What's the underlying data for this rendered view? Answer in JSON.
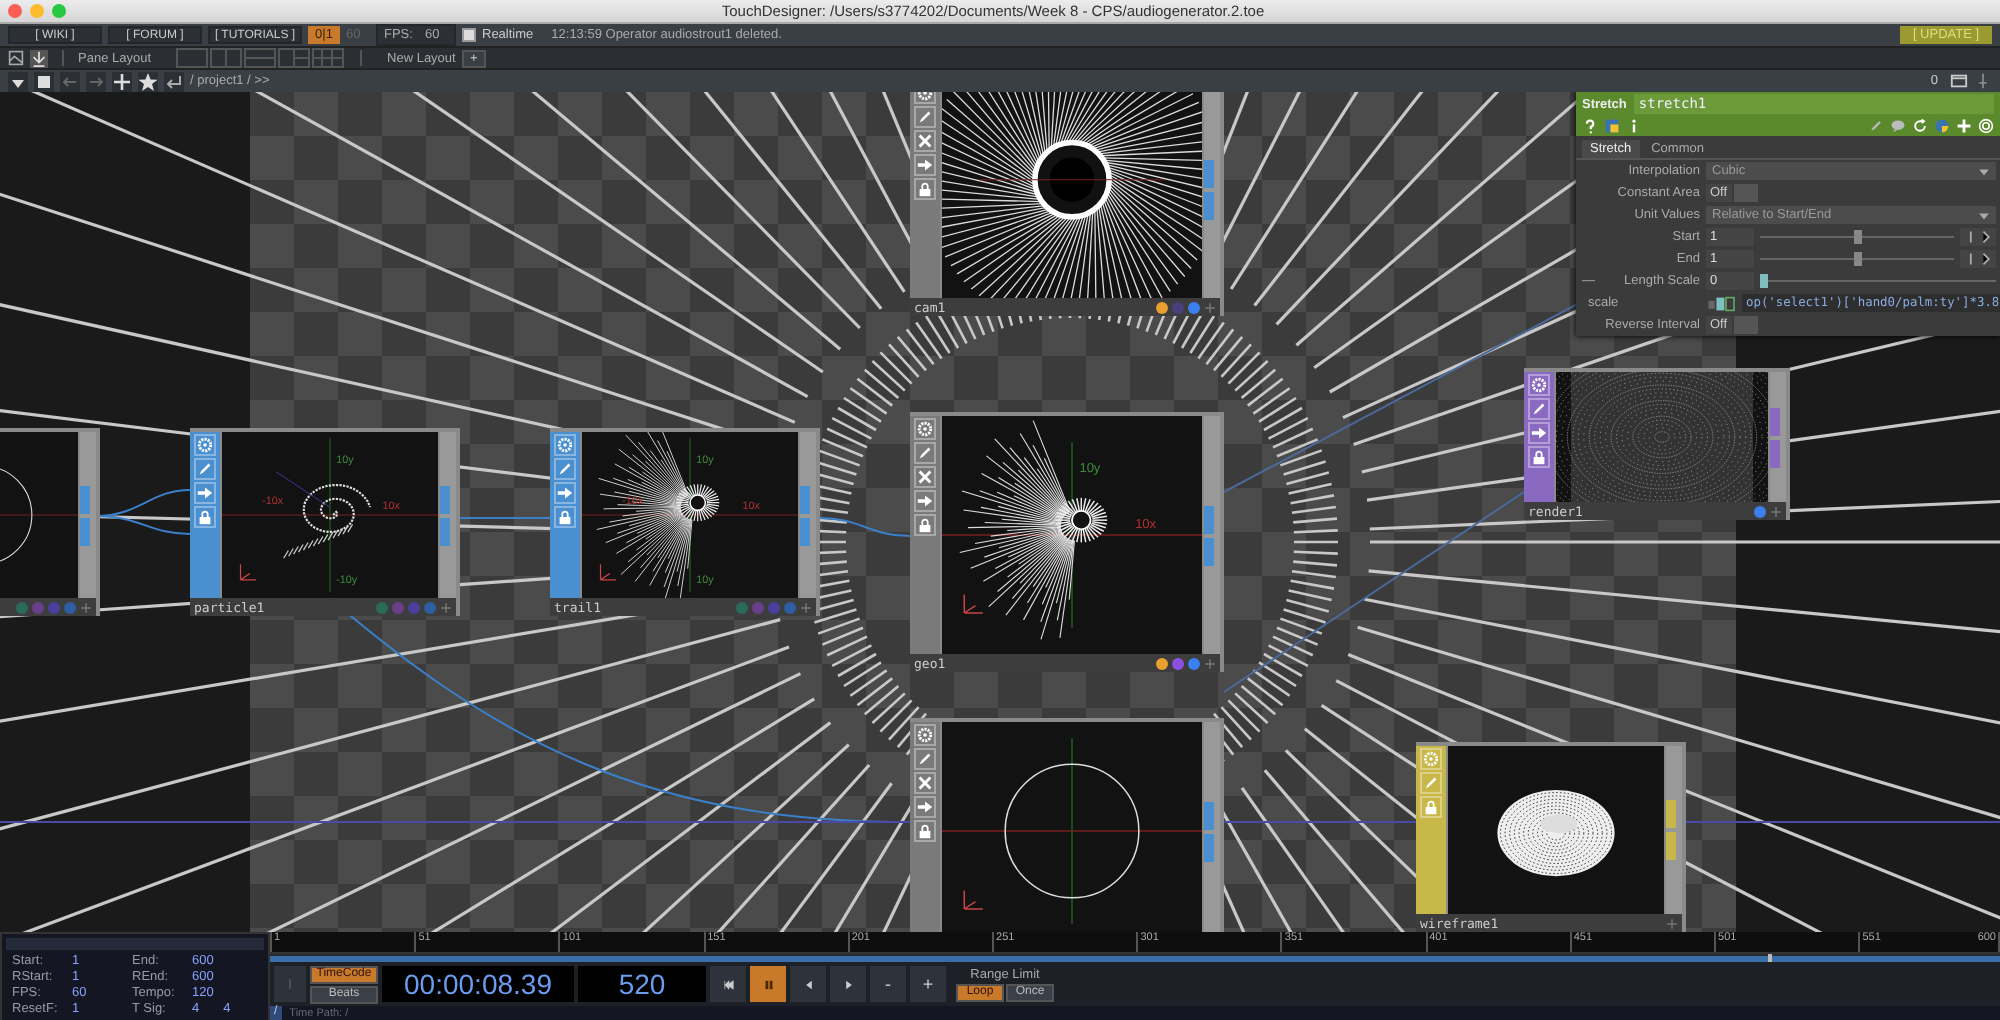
{
  "window": {
    "title": "TouchDesigner: /Users/s3774202/Documents/Week 8 - CPS/audiogenerator.2.toe"
  },
  "toolbar": {
    "links": [
      "[ WIKI ]",
      "[ FORUM ]",
      "[ TUTORIALS ]"
    ],
    "perform": {
      "label": "0|1",
      "on": true
    },
    "fps_cap": "60",
    "fps": {
      "label": "FPS:",
      "value": "60"
    },
    "realtime": {
      "label": "Realtime",
      "checked": true
    },
    "message": "12:13:59 Operator audiostrout1 deleted.",
    "update": "[ UPDATE ]"
  },
  "layout_bar": {
    "pane_layout": "Pane Layout",
    "new_layout": "New Layout",
    "add": "+"
  },
  "path_bar": {
    "path": "/ project1 / >>",
    "counter": "0"
  },
  "network": {
    "nodes": [
      {
        "kind": "sop",
        "viewer": {
          "kind": "ring"
        },
        "flags": [
          {
            "color": "#2a6b5a"
          },
          {
            "color": "#6a3f8a"
          },
          {
            "color": "#4a3f9a"
          },
          {
            "color": "#2f5fa0"
          }
        ]
      },
      {
        "name": "particle1",
        "kind": "sop",
        "color": "#4a8fd0",
        "viewer": {
          "kind": "spiral"
        },
        "labels": [
          {
            "kind": "top",
            "text": "10y"
          },
          {
            "kind": "left",
            "text": "-10x"
          },
          {
            "kind": "right",
            "text": "10x"
          },
          {
            "kind": "bottom",
            "text": "-10y"
          }
        ],
        "flags": [
          {
            "color": "#2a6b5a"
          },
          {
            "color": "#6a3f8a"
          },
          {
            "color": "#4a3f9a"
          },
          {
            "color": "#2f5fa0"
          }
        ]
      },
      {
        "name": "trail1",
        "kind": "sop",
        "color": "#4a8fd0",
        "viewer": {
          "kind": "burst"
        },
        "labels": [
          {
            "kind": "top",
            "text": "10y"
          },
          {
            "kind": "left",
            "text": "-10x"
          },
          {
            "kind": "right",
            "text": "10x"
          },
          {
            "kind": "bottom",
            "text": "10y"
          }
        ],
        "flags": [
          {
            "color": "#2a6b5a"
          },
          {
            "color": "#6a3f8a"
          },
          {
            "color": "#4a3f9a"
          },
          {
            "color": "#2f5fa0"
          }
        ]
      },
      {
        "name": "cam1",
        "kind": "comp",
        "color": "#7a7a7a",
        "viewer": {
          "kind": "tunnel"
        },
        "flags": [
          {
            "color": "#e8a030"
          },
          {
            "color": "#4a3f7a"
          },
          {
            "color": "#3a80f0"
          }
        ]
      },
      {
        "name": "geo1",
        "kind": "comp",
        "color": "#7a7a7a",
        "viewer": {
          "kind": "burst"
        },
        "labels": [
          {
            "kind": "top",
            "text": "10y"
          },
          {
            "kind": "right",
            "text": "10x"
          }
        ],
        "flags": [
          {
            "color": "#e8a030"
          },
          {
            "color": "#8a50e0"
          },
          {
            "color": "#3a80f0"
          }
        ]
      },
      {
        "kind": "comp",
        "color": "#7a7a7a",
        "viewer": {
          "kind": "ring"
        }
      },
      {
        "name": "render1",
        "kind": "top",
        "color": "#8a6ac0",
        "viewer": {
          "kind": "noise"
        },
        "flags": [
          {
            "color": "#3a80f0"
          }
        ]
      },
      {
        "name": "wireframe1",
        "kind": "mat",
        "color": "#c8b84a",
        "viewer": {
          "kind": "torus"
        }
      }
    ],
    "parameters": {
      "type": "Stretch",
      "name": "stretch1",
      "tabs": [
        {
          "label": "Stretch",
          "selected": true
        },
        {
          "label": "Common",
          "selected": false
        }
      ],
      "params": [
        {
          "kind": "menu",
          "label": "Interpolation",
          "value": "Cubic"
        },
        {
          "kind": "toggle",
          "label": "Constant Area",
          "value": "Off",
          "on": false
        },
        {
          "kind": "menu",
          "label": "Unit Values",
          "value": "Relative to Start/End"
        },
        {
          "kind": "slider",
          "label": "Start",
          "value": "1",
          "level": 0.5
        },
        {
          "kind": "slider",
          "label": "End",
          "value": "1",
          "level": 0.5
        },
        {
          "kind": "slider",
          "label": "Length Scale",
          "value": "0",
          "level": 0,
          "prefix": "—"
        },
        {
          "kind": "expression",
          "label": "scale",
          "value": "op('select1')['hand0/palm:ty']*3.8"
        },
        {
          "kind": "toggle",
          "label": "Reverse Interval",
          "value": "Off",
          "on": false
        }
      ]
    }
  },
  "timeline": {
    "info": [
      {
        "label": "Start:",
        "values": [
          "1"
        ]
      },
      {
        "label": "End:",
        "values": [
          "600"
        ]
      },
      {
        "label": "RStart:",
        "values": [
          "1"
        ]
      },
      {
        "label": "REnd:",
        "values": [
          "600"
        ]
      },
      {
        "label": "FPS:",
        "values": [
          "60"
        ]
      },
      {
        "label": "Tempo:",
        "values": [
          "120"
        ]
      },
      {
        "label": "ResetF:",
        "values": [
          "1"
        ]
      },
      {
        "label": "T Sig:",
        "values": [
          "4",
          "4"
        ]
      }
    ],
    "ruler": [
      "1",
      "51",
      "101",
      "151",
      "201",
      "251",
      "301",
      "351",
      "401",
      "451",
      "501",
      "551",
      "600"
    ],
    "playhead": {
      "level": 0.866
    },
    "modes": [
      {
        "label": "TimeCode",
        "selected": true
      },
      {
        "label": "Beats",
        "selected": false
      }
    ],
    "timecode": "00:00:08.39",
    "frame": "520",
    "transport": [
      {
        "kind": "rewind",
        "active": false
      },
      {
        "kind": "pause",
        "active": true
      },
      {
        "kind": "step-back",
        "active": false
      },
      {
        "kind": "step-forward",
        "active": false
      },
      {
        "kind": "text",
        "label": "-",
        "active": false
      },
      {
        "kind": "text",
        "label": "+",
        "active": false
      }
    ],
    "range": {
      "label": "Range Limit",
      "options": [
        {
          "label": "Loop",
          "selected": true
        },
        {
          "label": "Once",
          "selected": false
        }
      ]
    },
    "time_path": {
      "icon": "/",
      "label": "Time Path: /"
    }
  }
}
